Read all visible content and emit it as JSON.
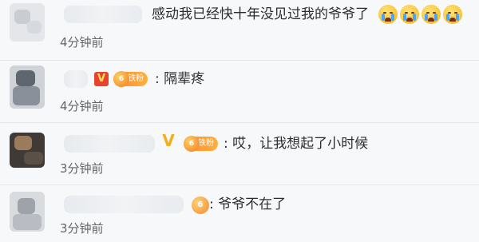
{
  "comments": [
    {
      "text": "感动我已经快十年没见过我的爷爷了",
      "time": "4分钟前",
      "emoji": [
        "crying-emoji",
        "crying-emoji",
        "crying-emoji",
        "crying-emoji"
      ]
    },
    {
      "vip_letter": "V",
      "fan_label": "铁粉",
      "text": ": 隔辈疼",
      "time": "4分钟前"
    },
    {
      "vip_letter": "V",
      "fan_label": "铁粉",
      "text": ": 哎，让我想起了小时候",
      "time": "3分钟前"
    },
    {
      "text": ": 爷爷不在了",
      "time": "3分钟前"
    }
  ]
}
